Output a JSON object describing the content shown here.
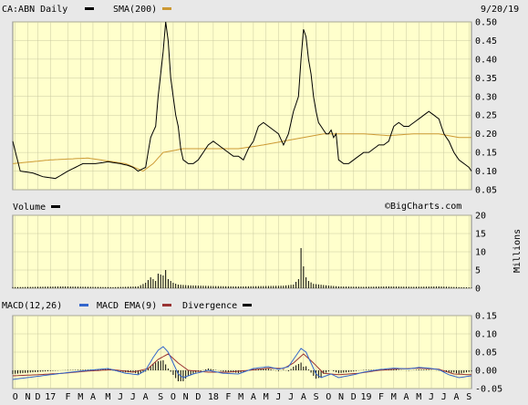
{
  "colors": {
    "background": "#e8e8e8",
    "plot_fill": "#ffffcc",
    "grid": "#c8c8a0",
    "price": "#000000",
    "sma": "#cc9933",
    "macd": "#3366cc",
    "macd_ema": "#993333",
    "divergence": "#000000"
  },
  "chart_data": [
    {
      "type": "line",
      "panel": "price",
      "legend_position": "top-left",
      "date_label": "9/20/19",
      "series": [
        {
          "name": "CA:ABN Daily",
          "role": "price",
          "color": "#000000"
        },
        {
          "name": "SMA(200)",
          "role": "sma",
          "color": "#cc9933"
        }
      ],
      "price_points": [
        [
          0,
          0.18
        ],
        [
          3,
          0.1
        ],
        [
          8,
          0.095
        ],
        [
          12,
          0.085
        ],
        [
          17,
          0.08
        ],
        [
          22,
          0.1
        ],
        [
          28,
          0.12
        ],
        [
          33,
          0.12
        ],
        [
          38,
          0.125
        ],
        [
          43,
          0.12
        ],
        [
          46,
          0.115
        ],
        [
          48,
          0.11
        ],
        [
          50,
          0.1
        ],
        [
          53,
          0.11
        ],
        [
          55,
          0.19
        ],
        [
          57,
          0.22
        ],
        [
          58,
          0.3
        ],
        [
          60,
          0.42
        ],
        [
          61,
          0.5
        ],
        [
          62,
          0.45
        ],
        [
          63,
          0.35
        ],
        [
          64,
          0.3
        ],
        [
          65,
          0.25
        ],
        [
          66,
          0.22
        ],
        [
          67,
          0.16
        ],
        [
          68,
          0.13
        ],
        [
          70,
          0.12
        ],
        [
          72,
          0.12
        ],
        [
          74,
          0.13
        ],
        [
          76,
          0.15
        ],
        [
          78,
          0.17
        ],
        [
          80,
          0.18
        ],
        [
          82,
          0.17
        ],
        [
          84,
          0.16
        ],
        [
          86,
          0.15
        ],
        [
          88,
          0.14
        ],
        [
          90,
          0.14
        ],
        [
          92,
          0.13
        ],
        [
          94,
          0.16
        ],
        [
          96,
          0.18
        ],
        [
          98,
          0.22
        ],
        [
          100,
          0.23
        ],
        [
          102,
          0.22
        ],
        [
          104,
          0.21
        ],
        [
          106,
          0.2
        ],
        [
          108,
          0.17
        ],
        [
          110,
          0.2
        ],
        [
          112,
          0.26
        ],
        [
          114,
          0.3
        ],
        [
          115,
          0.4
        ],
        [
          116,
          0.48
        ],
        [
          117,
          0.46
        ],
        [
          118,
          0.4
        ],
        [
          119,
          0.36
        ],
        [
          120,
          0.3
        ],
        [
          121,
          0.26
        ],
        [
          122,
          0.23
        ],
        [
          123,
          0.22
        ],
        [
          124,
          0.21
        ],
        [
          125,
          0.2
        ],
        [
          126,
          0.2
        ],
        [
          127,
          0.21
        ],
        [
          128,
          0.19
        ],
        [
          129,
          0.2
        ],
        [
          130,
          0.13
        ],
        [
          132,
          0.12
        ],
        [
          134,
          0.12
        ],
        [
          136,
          0.13
        ],
        [
          138,
          0.14
        ],
        [
          140,
          0.15
        ],
        [
          142,
          0.15
        ],
        [
          144,
          0.16
        ],
        [
          146,
          0.17
        ],
        [
          148,
          0.17
        ],
        [
          150,
          0.18
        ],
        [
          152,
          0.22
        ],
        [
          154,
          0.23
        ],
        [
          156,
          0.22
        ],
        [
          158,
          0.22
        ],
        [
          160,
          0.23
        ],
        [
          162,
          0.24
        ],
        [
          164,
          0.25
        ],
        [
          166,
          0.26
        ],
        [
          168,
          0.25
        ],
        [
          170,
          0.24
        ],
        [
          172,
          0.2
        ],
        [
          174,
          0.18
        ],
        [
          176,
          0.15
        ],
        [
          178,
          0.13
        ],
        [
          180,
          0.12
        ],
        [
          182,
          0.11
        ],
        [
          183,
          0.1
        ]
      ],
      "sma_points": [
        [
          0,
          0.12
        ],
        [
          15,
          0.13
        ],
        [
          30,
          0.135
        ],
        [
          45,
          0.12
        ],
        [
          52,
          0.1
        ],
        [
          56,
          0.12
        ],
        [
          60,
          0.15
        ],
        [
          68,
          0.16
        ],
        [
          80,
          0.16
        ],
        [
          90,
          0.16
        ],
        [
          100,
          0.17
        ],
        [
          108,
          0.18
        ],
        [
          116,
          0.19
        ],
        [
          124,
          0.2
        ],
        [
          132,
          0.2
        ],
        [
          140,
          0.2
        ],
        [
          150,
          0.195
        ],
        [
          160,
          0.2
        ],
        [
          170,
          0.2
        ],
        [
          178,
          0.19
        ],
        [
          183,
          0.19
        ]
      ],
      "ylim": [
        0.05,
        0.5
      ],
      "yticks": [
        "0.50",
        "0.45",
        "0.40",
        "0.35",
        "0.30",
        "0.25",
        "0.20",
        "0.15",
        "0.10",
        "0.05"
      ]
    },
    {
      "type": "bar",
      "panel": "volume",
      "legend_position": "top-left",
      "series": [
        {
          "name": "Volume",
          "color": "#000000"
        }
      ],
      "ylabel": "Millions",
      "ylim": [
        0,
        20
      ],
      "yticks": [
        "20",
        "15",
        "10",
        "5",
        "0"
      ],
      "credit": "©BigCharts.com",
      "volume_points": [
        [
          0,
          0.3
        ],
        [
          10,
          0.4
        ],
        [
          20,
          0.5
        ],
        [
          30,
          0.4
        ],
        [
          40,
          0.3
        ],
        [
          50,
          0.5
        ],
        [
          53,
          1.5
        ],
        [
          55,
          3.0
        ],
        [
          57,
          2.0
        ],
        [
          58,
          4.0
        ],
        [
          60,
          3.5
        ],
        [
          61,
          5.0
        ],
        [
          62,
          2.5
        ],
        [
          64,
          1.5
        ],
        [
          66,
          1.0
        ],
        [
          70,
          0.8
        ],
        [
          80,
          0.6
        ],
        [
          90,
          0.5
        ],
        [
          100,
          0.6
        ],
        [
          108,
          0.7
        ],
        [
          112,
          1.0
        ],
        [
          114,
          2.5
        ],
        [
          115,
          11.0
        ],
        [
          116,
          6.0
        ],
        [
          117,
          3.0
        ],
        [
          118,
          2.0
        ],
        [
          120,
          1.2
        ],
        [
          125,
          0.8
        ],
        [
          130,
          0.5
        ],
        [
          140,
          0.4
        ],
        [
          150,
          0.5
        ],
        [
          160,
          0.4
        ],
        [
          170,
          0.5
        ],
        [
          178,
          0.3
        ],
        [
          183,
          0.2
        ]
      ]
    },
    {
      "type": "line",
      "panel": "macd",
      "legend_position": "top-left",
      "series": [
        {
          "name": "MACD(12,26)",
          "color": "#3366cc"
        },
        {
          "name": "MACD EMA(9)",
          "color": "#993333"
        },
        {
          "name": "Divergence",
          "color": "#000000"
        }
      ],
      "ylim": [
        -0.05,
        0.15
      ],
      "yticks": [
        "0.15",
        "0.10",
        "0.05",
        "0.00",
        "-0.05"
      ],
      "macd_points": [
        [
          0,
          -0.025
        ],
        [
          8,
          -0.018
        ],
        [
          15,
          -0.012
        ],
        [
          22,
          -0.006
        ],
        [
          30,
          0.0
        ],
        [
          38,
          0.005
        ],
        [
          45,
          -0.008
        ],
        [
          50,
          -0.012
        ],
        [
          53,
          0.0
        ],
        [
          56,
          0.035
        ],
        [
          58,
          0.055
        ],
        [
          60,
          0.065
        ],
        [
          62,
          0.05
        ],
        [
          64,
          0.02
        ],
        [
          66,
          -0.01
        ],
        [
          68,
          -0.02
        ],
        [
          72,
          -0.01
        ],
        [
          78,
          0.0
        ],
        [
          84,
          -0.008
        ],
        [
          90,
          -0.01
        ],
        [
          96,
          0.005
        ],
        [
          102,
          0.01
        ],
        [
          106,
          0.003
        ],
        [
          110,
          0.01
        ],
        [
          113,
          0.04
        ],
        [
          115,
          0.06
        ],
        [
          117,
          0.05
        ],
        [
          119,
          0.02
        ],
        [
          121,
          -0.01
        ],
        [
          123,
          -0.02
        ],
        [
          127,
          -0.01
        ],
        [
          130,
          -0.02
        ],
        [
          136,
          -0.012
        ],
        [
          140,
          -0.005
        ],
        [
          146,
          0.002
        ],
        [
          152,
          0.006
        ],
        [
          158,
          0.004
        ],
        [
          162,
          0.008
        ],
        [
          166,
          0.006
        ],
        [
          170,
          0.002
        ],
        [
          174,
          -0.012
        ],
        [
          178,
          -0.02
        ],
        [
          183,
          -0.015
        ]
      ],
      "signal_points": [
        [
          0,
          -0.015
        ],
        [
          10,
          -0.012
        ],
        [
          20,
          -0.008
        ],
        [
          30,
          -0.002
        ],
        [
          40,
          0.002
        ],
        [
          48,
          -0.005
        ],
        [
          54,
          0.005
        ],
        [
          58,
          0.03
        ],
        [
          62,
          0.045
        ],
        [
          66,
          0.02
        ],
        [
          70,
          0.0
        ],
        [
          78,
          -0.005
        ],
        [
          86,
          -0.005
        ],
        [
          94,
          0.0
        ],
        [
          102,
          0.006
        ],
        [
          108,
          0.005
        ],
        [
          112,
          0.02
        ],
        [
          116,
          0.045
        ],
        [
          120,
          0.02
        ],
        [
          124,
          -0.008
        ],
        [
          130,
          -0.012
        ],
        [
          138,
          -0.008
        ],
        [
          146,
          0.0
        ],
        [
          154,
          0.004
        ],
        [
          162,
          0.006
        ],
        [
          170,
          0.003
        ],
        [
          176,
          -0.01
        ],
        [
          183,
          -0.012
        ]
      ]
    }
  ],
  "x_axis": {
    "n_points": 184,
    "ticks": [
      {
        "label": "O",
        "i": 1
      },
      {
        "label": "N",
        "i": 6
      },
      {
        "label": "D",
        "i": 10
      },
      {
        "label": "17",
        "i": 15
      },
      {
        "label": "F",
        "i": 22
      },
      {
        "label": "M",
        "i": 27
      },
      {
        "label": "A",
        "i": 32
      },
      {
        "label": "M",
        "i": 38
      },
      {
        "label": "J",
        "i": 43
      },
      {
        "label": "J",
        "i": 48
      },
      {
        "label": "A",
        "i": 53
      },
      {
        "label": "S",
        "i": 59
      },
      {
        "label": "O",
        "i": 64
      },
      {
        "label": "N",
        "i": 69
      },
      {
        "label": "D",
        "i": 74
      },
      {
        "label": "18",
        "i": 80
      },
      {
        "label": "F",
        "i": 86
      },
      {
        "label": "M",
        "i": 91
      },
      {
        "label": "A",
        "i": 96
      },
      {
        "label": "M",
        "i": 101
      },
      {
        "label": "J",
        "i": 106
      },
      {
        "label": "J",
        "i": 111
      },
      {
        "label": "A",
        "i": 116
      },
      {
        "label": "S",
        "i": 121
      },
      {
        "label": "O",
        "i": 126
      },
      {
        "label": "N",
        "i": 131
      },
      {
        "label": "D",
        "i": 136
      },
      {
        "label": "19",
        "i": 141
      },
      {
        "label": "F",
        "i": 147
      },
      {
        "label": "M",
        "i": 152
      },
      {
        "label": "A",
        "i": 157
      },
      {
        "label": "M",
        "i": 162
      },
      {
        "label": "J",
        "i": 167
      },
      {
        "label": "J",
        "i": 172
      },
      {
        "label": "A",
        "i": 177
      },
      {
        "label": "S",
        "i": 182
      }
    ]
  }
}
